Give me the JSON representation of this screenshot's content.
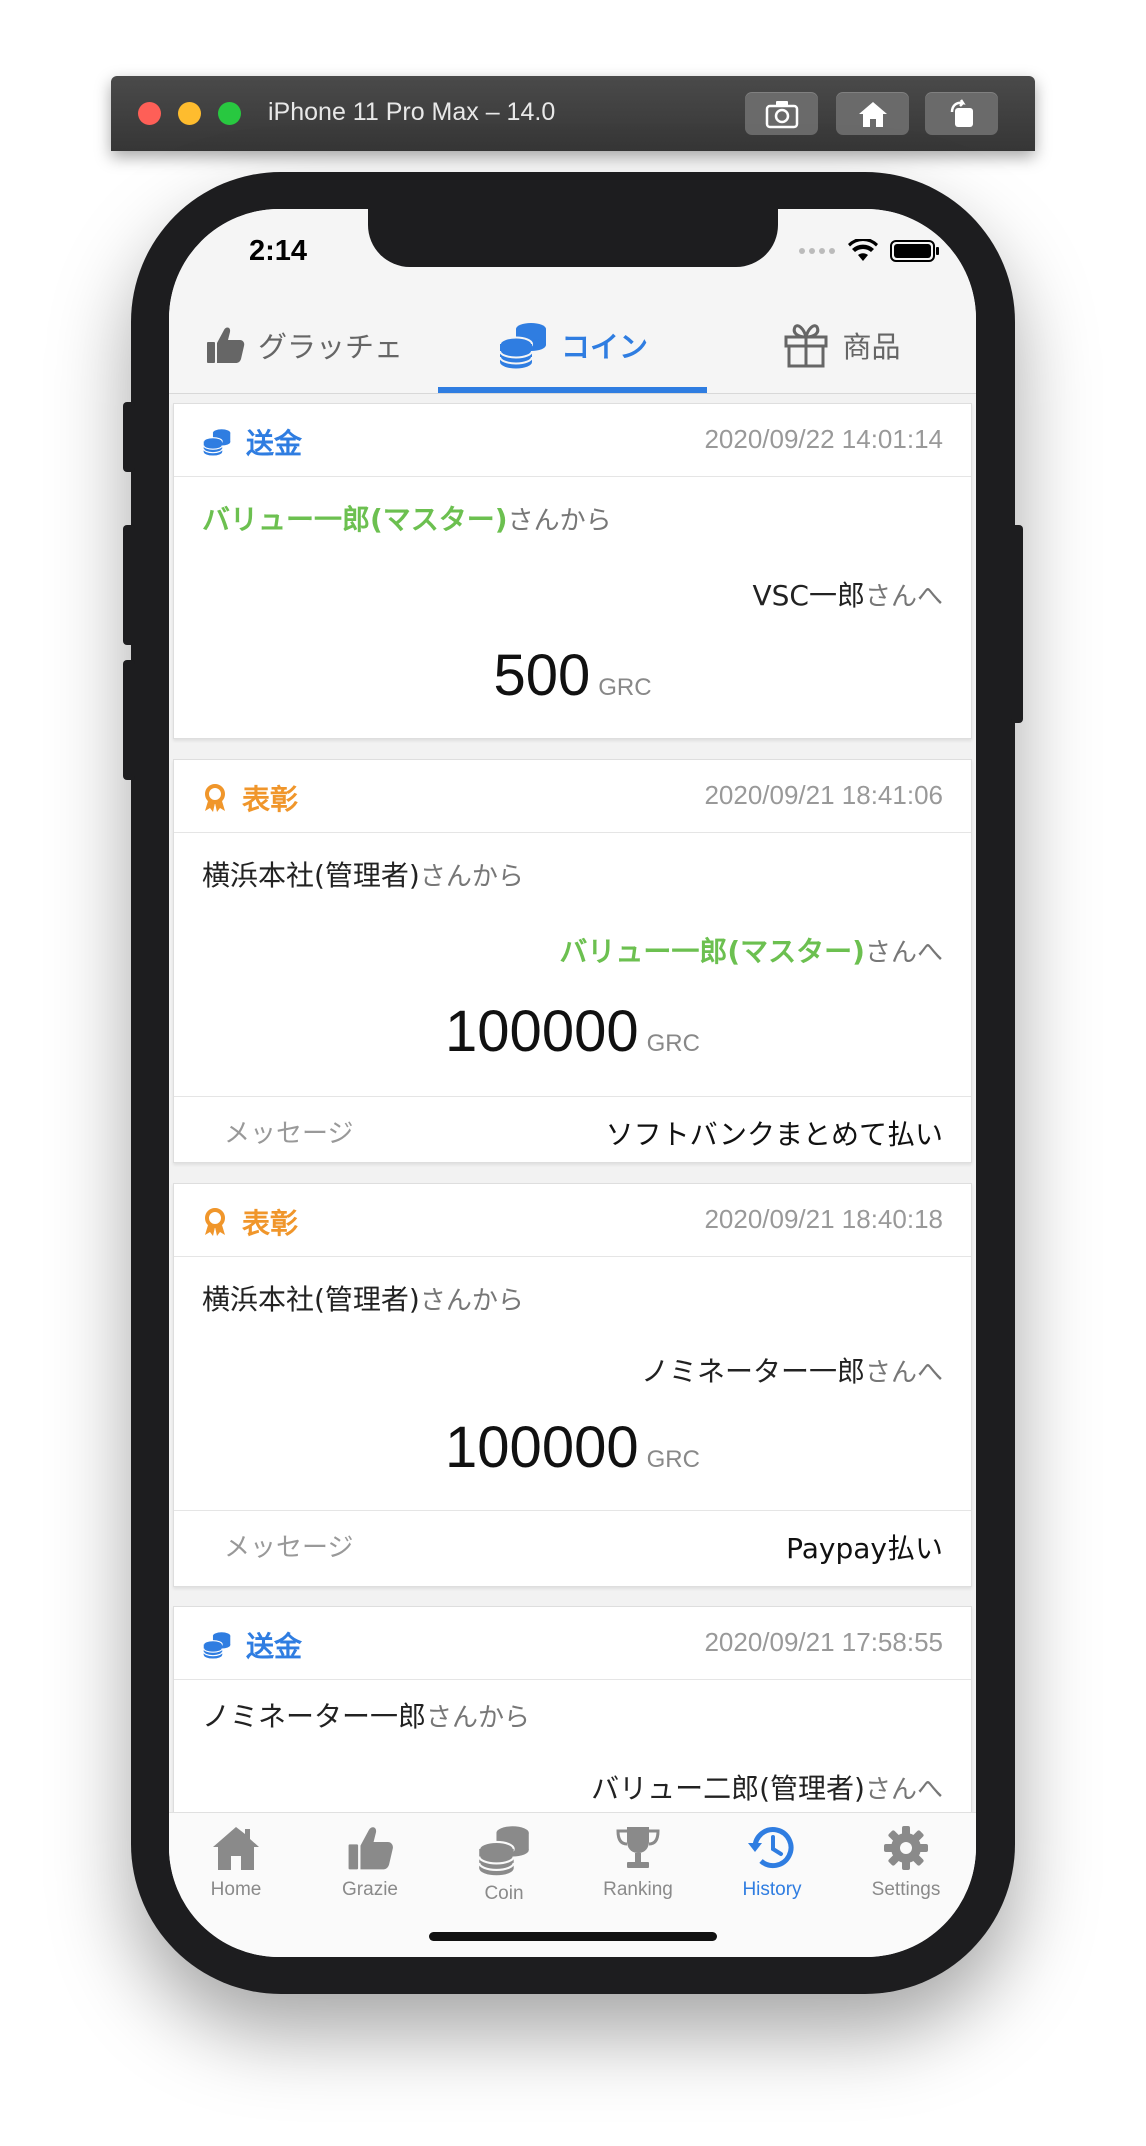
{
  "simulator": {
    "title": "iPhone 11 Pro Max – 14.0"
  },
  "status": {
    "time": "2:14"
  },
  "top_tabs": [
    {
      "label": "グラッチェ",
      "icon": "thumbs-up-icon",
      "active": false
    },
    {
      "label": "コイン",
      "icon": "coins-icon",
      "active": true
    },
    {
      "label": "商品",
      "icon": "gift-icon",
      "active": false
    }
  ],
  "transactions": [
    {
      "type": "送金",
      "kind": "send",
      "date": "2020/09/22 14:01:14",
      "from": "バリュー一郎(マスター)",
      "from_suffix": "さんから",
      "to": "VSC一郎",
      "to_suffix": "さんへ",
      "amount": "500",
      "unit": "GRC"
    },
    {
      "type": "表彰",
      "kind": "award",
      "date": "2020/09/21 18:41:06",
      "from": "横浜本社(管理者)",
      "from_suffix": "さんから",
      "to": "バリュー一郎(マスター)",
      "to_suffix": "さんへ",
      "amount": "100000",
      "unit": "GRC",
      "message_label": "メッセージ",
      "message": "ソフトバンクまとめて払い"
    },
    {
      "type": "表彰",
      "kind": "award",
      "date": "2020/09/21 18:40:18",
      "from": "横浜本社(管理者)",
      "from_suffix": "さんから",
      "to": "ノミネーター一郎",
      "to_suffix": "さんへ",
      "amount": "100000",
      "unit": "GRC",
      "message_label": "メッセージ",
      "message": "Paypay払い"
    },
    {
      "type": "送金",
      "kind": "send",
      "date": "2020/09/21 17:58:55",
      "from": "ノミネーター一郎",
      "from_suffix": "さんから",
      "to": "バリュー二郎(管理者)",
      "to_suffix": "さんへ"
    }
  ],
  "bottom_nav": [
    {
      "label": "Home",
      "icon": "home-icon",
      "active": false
    },
    {
      "label": "Grazie",
      "icon": "thumbs-up-icon",
      "active": false
    },
    {
      "label": "Coin",
      "icon": "coins-icon",
      "active": false
    },
    {
      "label": "Ranking",
      "icon": "trophy-icon",
      "active": false
    },
    {
      "label": "History",
      "icon": "history-icon",
      "active": true
    },
    {
      "label": "Settings",
      "icon": "gear-icon",
      "active": false
    }
  ],
  "colors": {
    "accent": "#2f7de1",
    "award": "#f0962b",
    "green": "#6cc050"
  }
}
